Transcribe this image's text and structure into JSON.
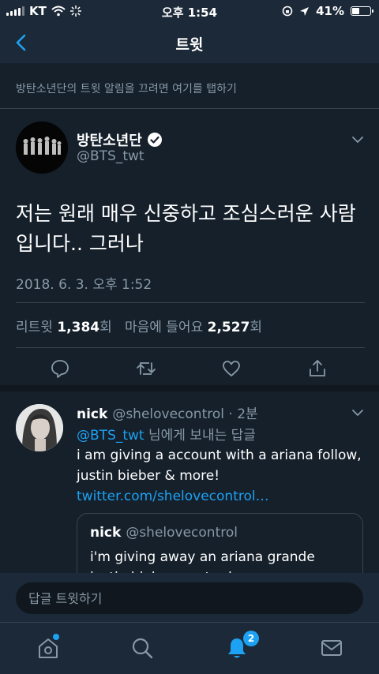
{
  "status_bar": {
    "carrier": "KT",
    "time": "오후 1:54",
    "battery_percent": "41%",
    "battery_level": 0.41
  },
  "nav": {
    "title": "트윗",
    "back_icon": "chevron-left-icon"
  },
  "notice": "방탄소년단의 트윗 알림을 끄려면 여기를 탭하기",
  "tweet": {
    "author_name": "방탄소년단",
    "verified_icon": "verified-badge-icon",
    "handle": "@BTS_twt",
    "text": "저는 원래 매우 신중하고 조심스러운 사람입니다.. 그러나",
    "timestamp": "2018. 6. 3. 오후 1:52",
    "retweet_label": "리트윗",
    "retweet_count": "1,384",
    "retweet_unit": "회",
    "like_label": "마음에 들어요",
    "like_count": "2,527",
    "like_unit": "회"
  },
  "reply": {
    "name": "nick",
    "handle": "@shelovecontrol",
    "age": "· 2분",
    "to_handle": "@BTS_twt",
    "to_suffix": " 님에게 보내는 답글",
    "text": "i am giving a account with a ariana follow, justin bieber & more!",
    "link": "twitter.com/shelovecontrol…",
    "quote": {
      "name": "nick",
      "handle": "@shelovecontrol",
      "text": "i'm giving away an ariana grande justin bieber, caster brown"
    }
  },
  "compose": {
    "placeholder": "답글 트윗하기"
  },
  "tab_bar": {
    "notifications_badge": "2"
  },
  "colors": {
    "background": "#15202b",
    "bar": "#1c2938",
    "accent": "#1da1f2",
    "secondary_text": "#8899a6"
  }
}
